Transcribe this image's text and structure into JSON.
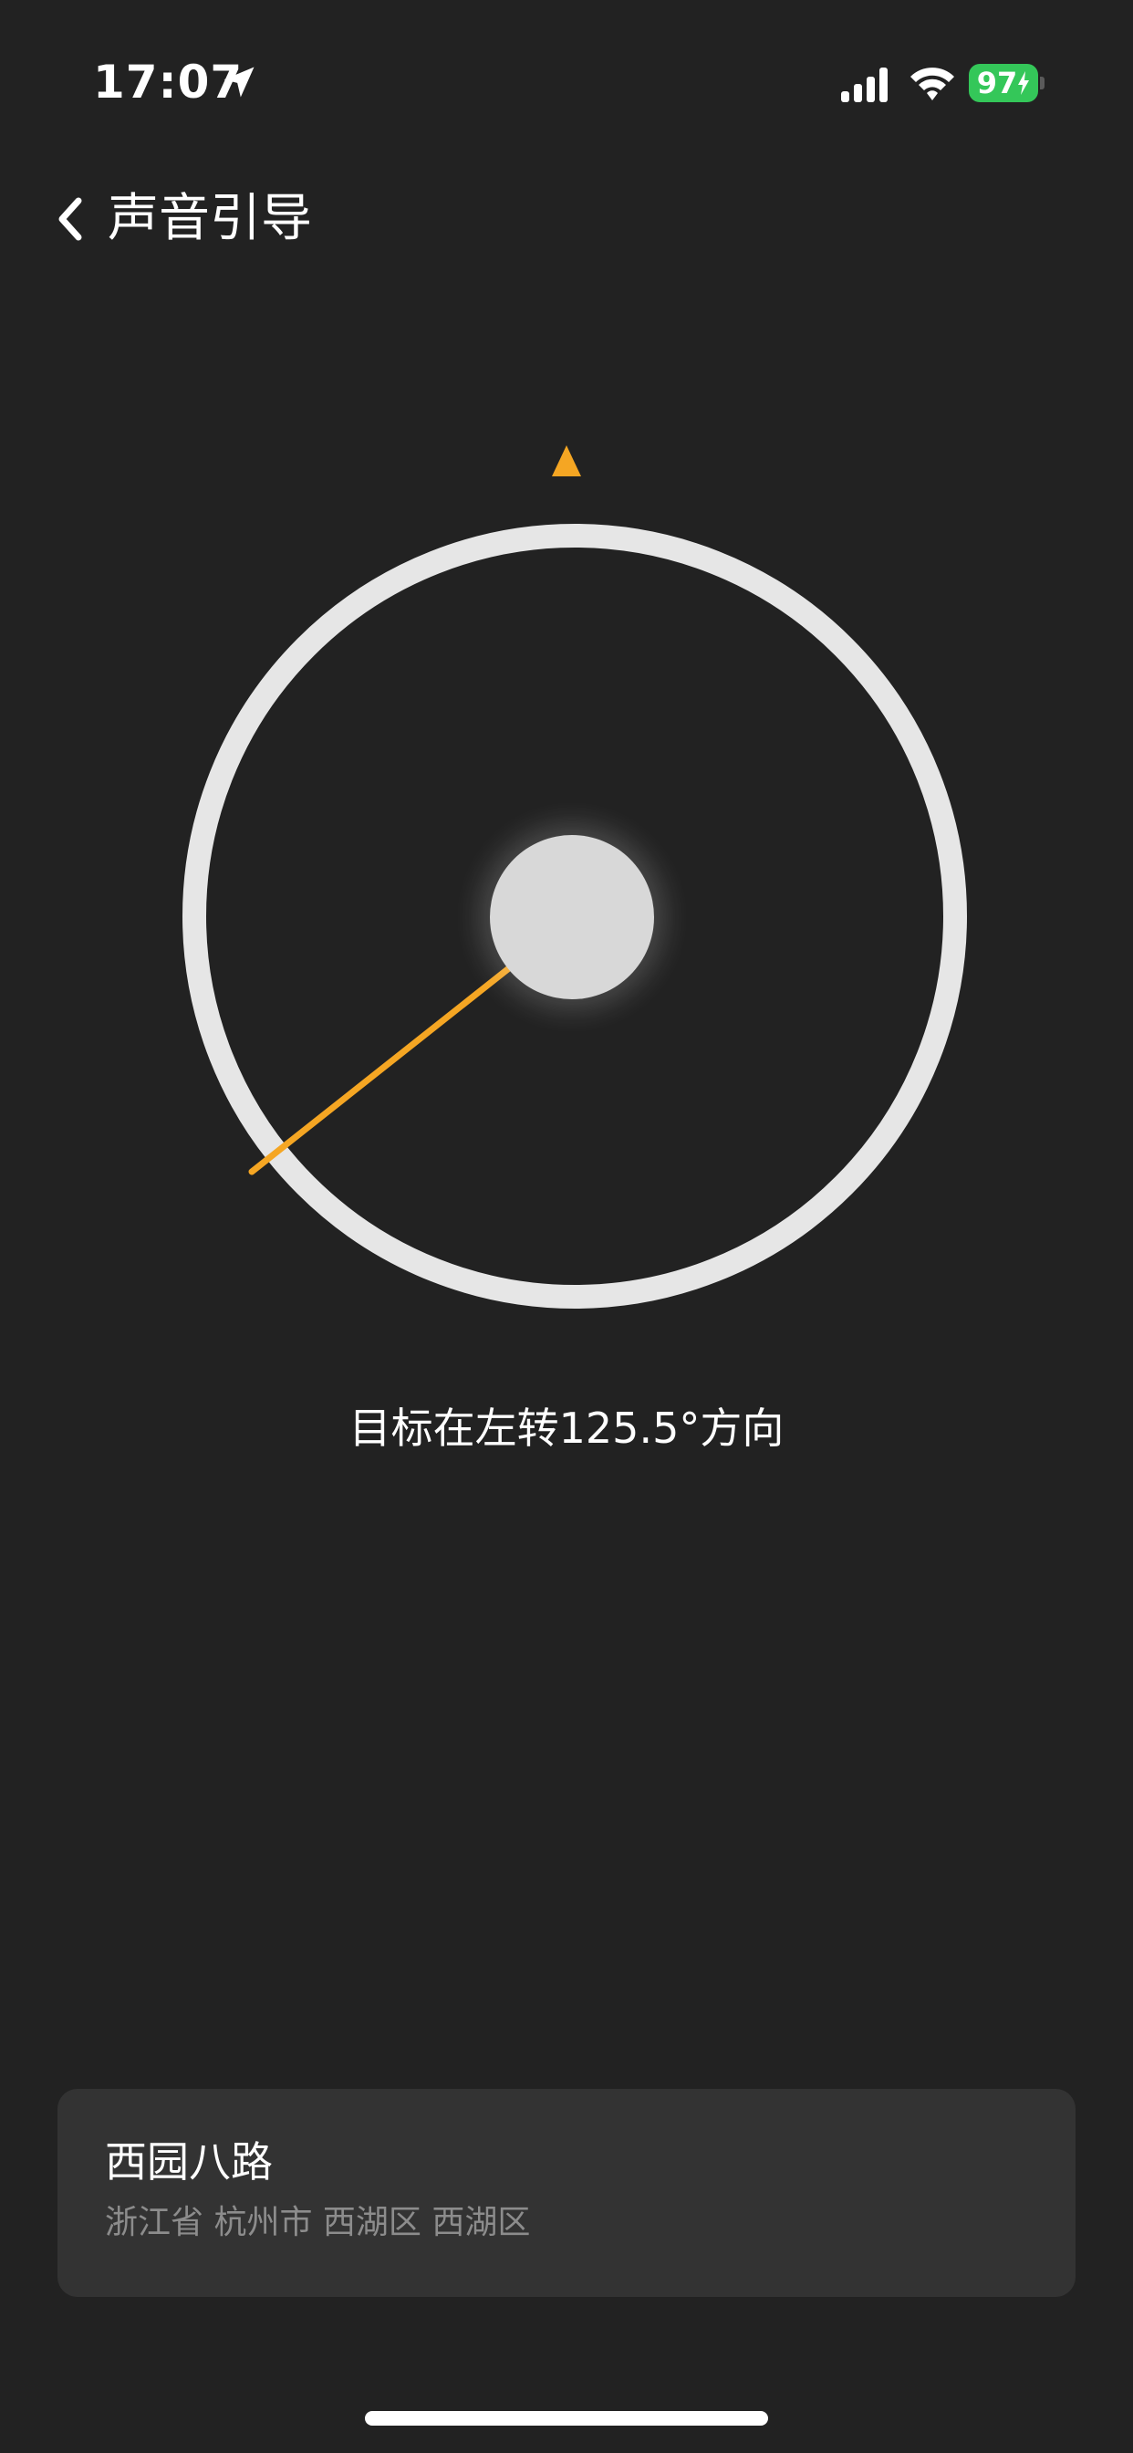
{
  "status_bar": {
    "time": "17:07",
    "battery_level": "97",
    "icons": [
      "location-arrow-icon",
      "cellular-signal-icon",
      "wifi-icon",
      "battery-charging-icon"
    ],
    "battery_color": "#34c759"
  },
  "nav": {
    "title": "声音引导",
    "back_icon": "chevron-left-icon"
  },
  "compass": {
    "pointer_color": "#f5a623",
    "ring_color": "#e6e6e6",
    "target_bearing_deg": -125.5
  },
  "direction": {
    "text": "目标在左转125.5°方向"
  },
  "place": {
    "name": "西园八路",
    "address": "浙江省 杭州市 西湖区 西湖区"
  }
}
